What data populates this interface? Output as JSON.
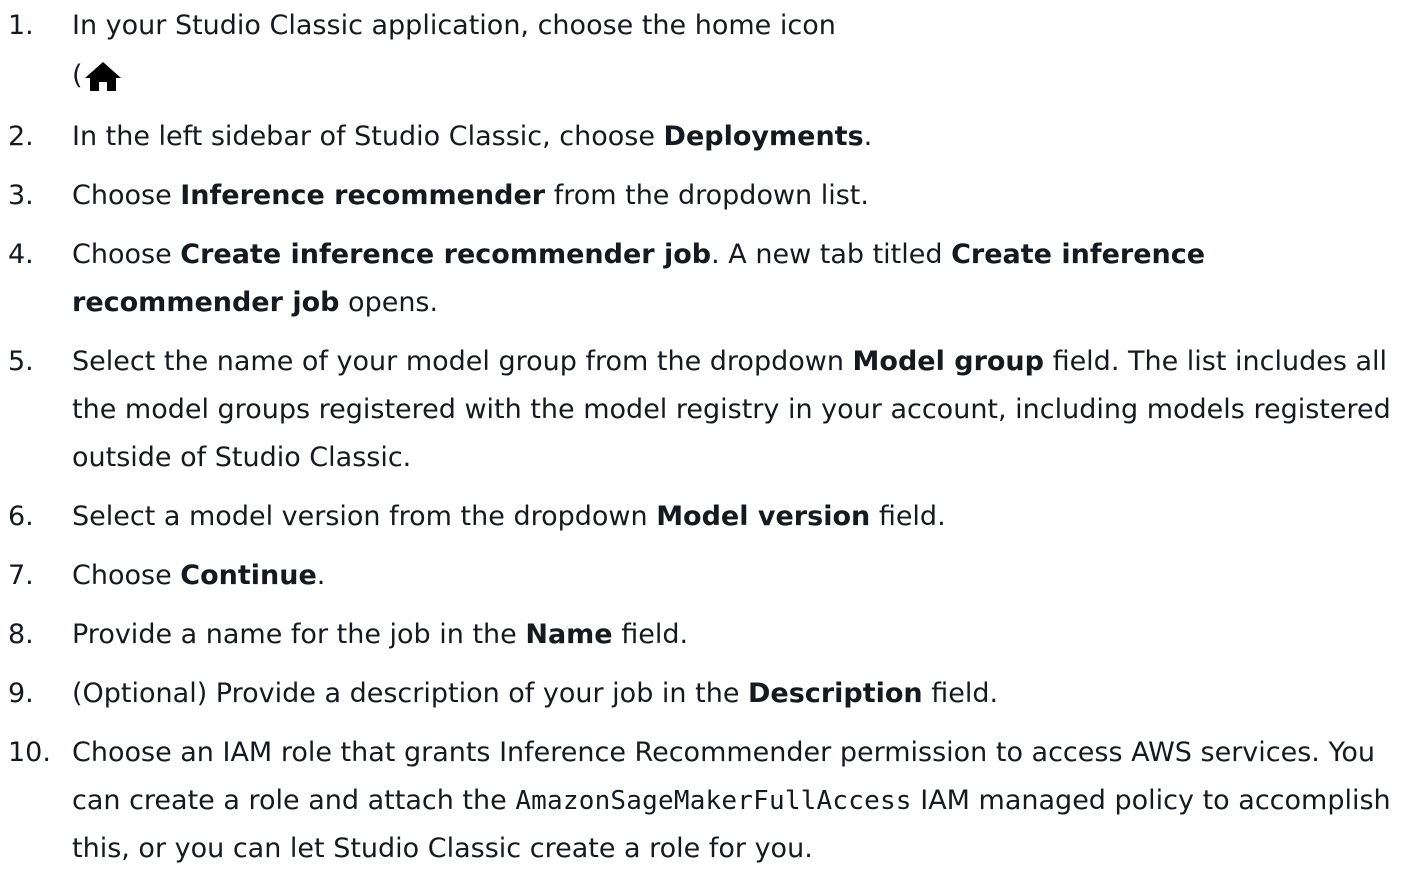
{
  "steps": [
    {
      "number": "1.",
      "segments": [
        {
          "text": "In your Studio Classic application, choose the home icon",
          "style": "normal"
        }
      ],
      "icon_prefix": "(",
      "icon": "home-icon"
    },
    {
      "number": "2.",
      "segments": [
        {
          "text": "In the left sidebar of Studio Classic, choose ",
          "style": "normal"
        },
        {
          "text": "Deployments",
          "style": "bold"
        },
        {
          "text": ".",
          "style": "normal"
        }
      ]
    },
    {
      "number": "3.",
      "segments": [
        {
          "text": "Choose ",
          "style": "normal"
        },
        {
          "text": "Inference recommender",
          "style": "bold"
        },
        {
          "text": " from the dropdown list.",
          "style": "normal"
        }
      ]
    },
    {
      "number": "4.",
      "segments": [
        {
          "text": "Choose ",
          "style": "normal"
        },
        {
          "text": "Create inference recommender job",
          "style": "bold"
        },
        {
          "text": ". A new tab titled ",
          "style": "normal"
        },
        {
          "text": "Create inference recommender job",
          "style": "bold"
        },
        {
          "text": " opens.",
          "style": "normal"
        }
      ]
    },
    {
      "number": "5.",
      "segments": [
        {
          "text": "Select the name of your model group from the dropdown ",
          "style": "normal"
        },
        {
          "text": "Model group",
          "style": "bold"
        },
        {
          "text": " field. The list includes all the model groups registered with the model registry in your account, including models registered outside of Studio Classic.",
          "style": "normal"
        }
      ]
    },
    {
      "number": "6.",
      "segments": [
        {
          "text": "Select a model version from the dropdown ",
          "style": "normal"
        },
        {
          "text": "Model version",
          "style": "bold"
        },
        {
          "text": " field.",
          "style": "normal"
        }
      ]
    },
    {
      "number": "7.",
      "segments": [
        {
          "text": "Choose ",
          "style": "normal"
        },
        {
          "text": "Continue",
          "style": "bold"
        },
        {
          "text": ".",
          "style": "normal"
        }
      ]
    },
    {
      "number": "8.",
      "segments": [
        {
          "text": "Provide a name for the job in the ",
          "style": "normal"
        },
        {
          "text": "Name",
          "style": "bold"
        },
        {
          "text": " field.",
          "style": "normal"
        }
      ]
    },
    {
      "number": "9.",
      "segments": [
        {
          "text": "(Optional) Provide a description of your job in the ",
          "style": "normal"
        },
        {
          "text": "Description",
          "style": "bold"
        },
        {
          "text": " field.",
          "style": "normal"
        }
      ]
    },
    {
      "number": "10.",
      "segments": [
        {
          "text": "Choose an IAM role that grants Inference Recommender permission to access AWS services. You can create a role and attach the ",
          "style": "normal"
        },
        {
          "text": "AmazonSageMakerFullAccess",
          "style": "code"
        },
        {
          "text": " IAM managed policy to accomplish this, or you can let Studio Classic create a role for you.",
          "style": "normal"
        }
      ]
    }
  ],
  "colors": {
    "text": "#16191f",
    "background": "#ffffff"
  }
}
